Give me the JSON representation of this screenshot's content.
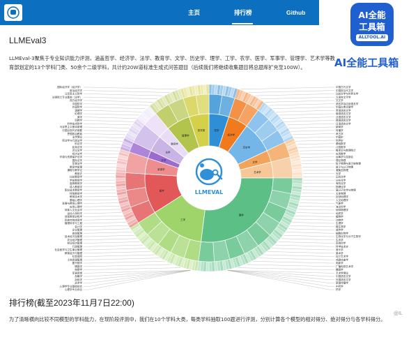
{
  "nav": {
    "items": [
      "主页",
      "排行榜",
      "Github"
    ],
    "active_index": 1
  },
  "watermark": {
    "tile_line1": "AI全能",
    "tile_line2": "工具箱",
    "tile_line3": "ALLTOOL.AI",
    "caption": "AI全能工具箱"
  },
  "page": {
    "title": "LLMEval3",
    "description": "LLMEval-3聚焦于专业知识能力评测，涵盖哲学、经济学、法学、教育学、文学、历史学、理学、工学、农学、医学、军事学、管理学、艺术学等教育部划定的13个学科门类、50余个二级学科，共计约20W道标准生成式问答题目（后续我们将继续收集题目将总题库扩充至100W）。",
    "ranking_title": "排行榜(截至2023年11月7日22:00)",
    "ranking_description": "为了清晰横向比较不同模型的学科能力，在现阶段评测中，我们在10个学科大类，每类学科抽取100题进行评测，分别计算各个模型的相对得分、绝对得分与各学科得分。",
    "center_logo_text": "LLMEVAL",
    "corner_mark": "@IL"
  },
  "chart_data": {
    "type": "sunburst",
    "title": "",
    "center_label": "LLMEVAL",
    "inner_ring": [
      {
        "name": "哲学",
        "value": 5,
        "color": "#2e8fd6"
      },
      {
        "name": "经济学",
        "value": 5,
        "color": "#f07a1e"
      },
      {
        "name": "历史学",
        "value": 8,
        "color": "#74b6e8"
      },
      {
        "name": "文学",
        "value": 3,
        "color": "#f3a35a"
      },
      {
        "name": "艺术学",
        "value": 4,
        "color": "#f7c797"
      },
      {
        "name": "理学",
        "value": 27,
        "color": "#5cbf86"
      },
      {
        "name": "工学",
        "value": 14,
        "color": "#9ed46a"
      },
      {
        "name": "医学",
        "value": 10,
        "color": "#e25757"
      },
      {
        "name": "军事学",
        "value": 4,
        "color": "#ee8d8d"
      },
      {
        "name": "农学",
        "value": 2,
        "color": "#9c6bd1"
      },
      {
        "name": "法学",
        "value": 4,
        "color": "#c9b4e6"
      },
      {
        "name": "教育学",
        "value": 3,
        "color": "#e9dcf5"
      },
      {
        "name": "管理学",
        "value": 6,
        "color": "#b3c44c"
      },
      {
        "name": "哲学类",
        "value": 5,
        "color": "#d4d04a"
      }
    ],
    "left_labels": [
      "国际经济学（经济学）",
      "政治经济学",
      "马克思主义哲学",
      "法律硕士专业基础（法学）",
      "西方经济学",
      "中国哲学",
      "外国哲学",
      "逻辑学",
      "伦理学",
      "美学",
      "宗教学",
      "科学技术哲学",
      "马克思主义基本原理",
      "中国近现代史纲要",
      "思想政治教育",
      "法学理论",
      "宪法学与行政法学",
      "刑法学",
      "民商法学",
      "诉讼法学",
      "经济法学",
      "环境与资源保护法学",
      "国际法学",
      "军事法学",
      "教育学原理",
      "课程与教学论",
      "教育史",
      "比较教育学",
      "学前教育学",
      "高等教育学",
      "成人教育学",
      "职业技术教育学",
      "特殊教育学",
      "教育技术学",
      "基础心理学",
      "发展与教育心理学",
      "应用心理学",
      "体育人文社会学",
      "运动人体科学",
      "体育教育训练学",
      "民族传统体育学",
      "管理科学与工程",
      "会计学",
      "企业管理",
      "旅游管理",
      "技术经济及管理",
      "农业经济管理",
      "林业经济管理",
      "行政管理",
      "社会医学与卫生事业管理",
      "教育经济与管理",
      "社会保障",
      "土地资源管理",
      "图书馆学",
      "情报学",
      "档案学",
      "军事思想",
      "战略学",
      "战役学",
      "战术学",
      "心理学专业基础综合",
      "心理学专业综合"
    ],
    "right_labels": [
      "中国古代文学",
      "中国现当代文学",
      "比较文学与世界文学",
      "汉语言文字学",
      "文艺学",
      "语言学及应用语言学",
      "中国古典文献学",
      "英语语言文学",
      "俄语语言文学",
      "法语语言文学",
      "德语语言文学",
      "日语语言文学",
      "新闻学",
      "传播学",
      "考古学",
      "中国史",
      "世界史",
      "基础数学",
      "计算数学",
      "概率论与数理统计",
      "应用数学",
      "运筹学与控制论",
      "理论物理",
      "粒子物理与原子核物理",
      "原子与分子物理",
      "凝聚态物理",
      "光学",
      "无机化学",
      "分析化学",
      "有机化学",
      "物理化学",
      "高分子化学与物理",
      "天体物理",
      "自然地理学",
      "人文地理学",
      "气象学",
      "海洋科学",
      "地球物理学",
      "地质学",
      "植物学",
      "动物学",
      "生理学",
      "微生物学",
      "遗传学",
      "细胞生物学",
      "生物化学与分子生物学",
      "生态学",
      "系统科学",
      "科学技术史",
      "音乐学",
      "美术学",
      "设计艺术学",
      "戏剧戏曲学",
      "电影学",
      "广播电视艺术学",
      "舞蹈学",
      "艺术学理论",
      "中国语言文学",
      "外国语言文学",
      "新闻传播学",
      "中药学",
      "药学"
    ]
  }
}
